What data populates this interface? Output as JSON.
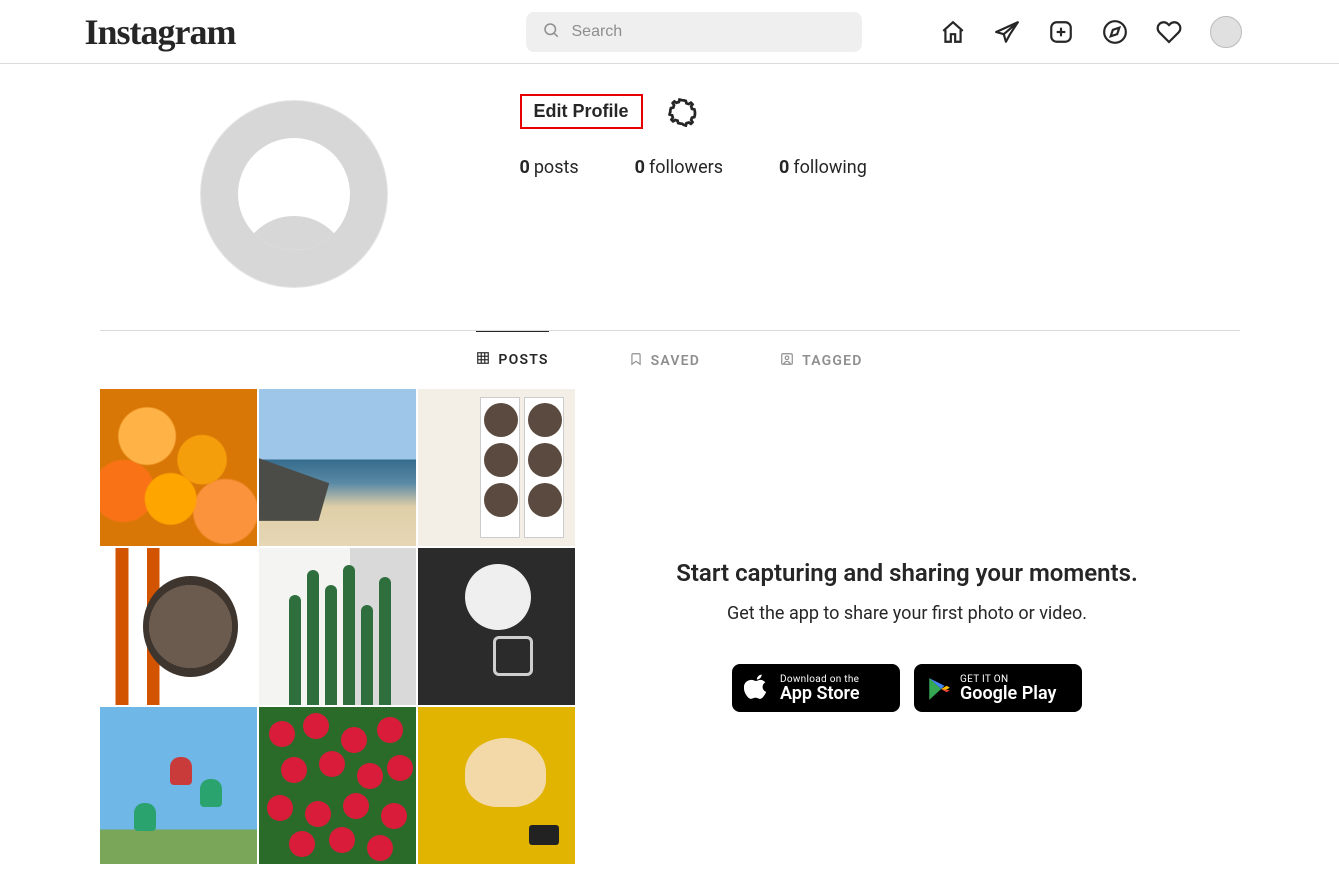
{
  "app": {
    "name": "Instagram"
  },
  "search": {
    "placeholder": "Search"
  },
  "profile": {
    "edit_label": "Edit Profile",
    "stats": {
      "posts_count": "0",
      "posts_label": "posts",
      "followers_count": "0",
      "followers_label": "followers",
      "following_count": "0",
      "following_label": "following"
    }
  },
  "tabs": {
    "posts": "POSTS",
    "saved": "SAVED",
    "tagged": "TAGGED"
  },
  "promo": {
    "headline": "Start capturing and sharing your moments.",
    "sub": "Get the app to share your first photo or video.",
    "appstore_small": "Download on the",
    "appstore_big": "App Store",
    "gplay_small": "GET IT ON",
    "gplay_big": "Google Play"
  },
  "icons": {
    "home": "home-icon",
    "messages": "messages-icon",
    "new_post": "new-post-icon",
    "explore": "explore-icon",
    "activity": "activity-icon",
    "settings": "settings-gear-icon",
    "search": "search-icon",
    "grid": "grid-icon",
    "bookmark": "bookmark-icon",
    "tagged": "tagged-icon"
  },
  "colors": {
    "highlight_border": "#e60000"
  }
}
